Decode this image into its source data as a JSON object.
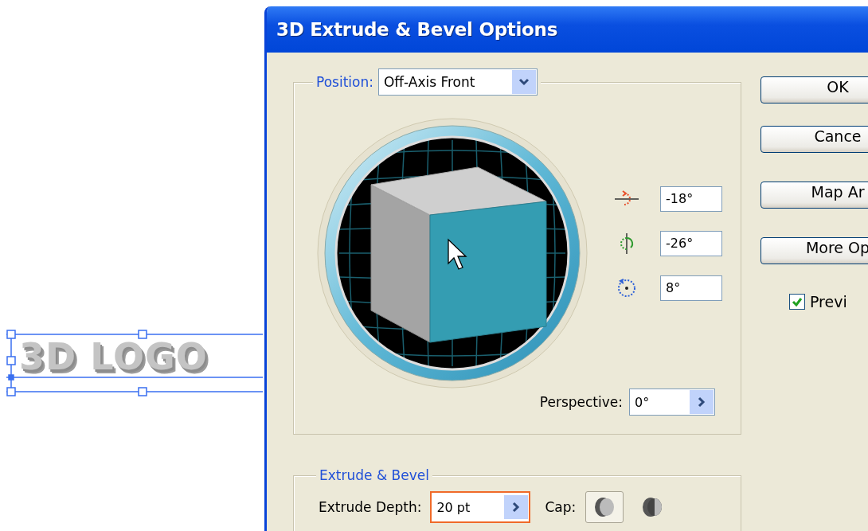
{
  "artboard": {
    "artwork_text": "3D LOGO",
    "selected": true
  },
  "window": {
    "title": "3D Extrude & Bevel Options"
  },
  "position": {
    "label": "Position:",
    "value": "Off-Axis Front"
  },
  "rotation": [
    {
      "kind": "x",
      "value": "-18°"
    },
    {
      "kind": "y",
      "value": "-26°"
    },
    {
      "kind": "z",
      "value": "8°"
    }
  ],
  "perspective": {
    "label": "Perspective:",
    "value": "0°"
  },
  "extrude_bevel": {
    "title": "Extrude & Bevel",
    "depth_label": "Extrude Depth:",
    "depth_value": "20 pt",
    "focused": true,
    "cap_label": "Cap:",
    "caps": [
      {
        "selected": true
      },
      {
        "selected": false
      }
    ]
  },
  "buttons": [
    {
      "label": "OK"
    },
    {
      "label": "Cance"
    },
    {
      "label": "Map Ar"
    },
    {
      "label": "More Op"
    }
  ],
  "preview": {
    "label": "Previ",
    "checked": true
  }
}
